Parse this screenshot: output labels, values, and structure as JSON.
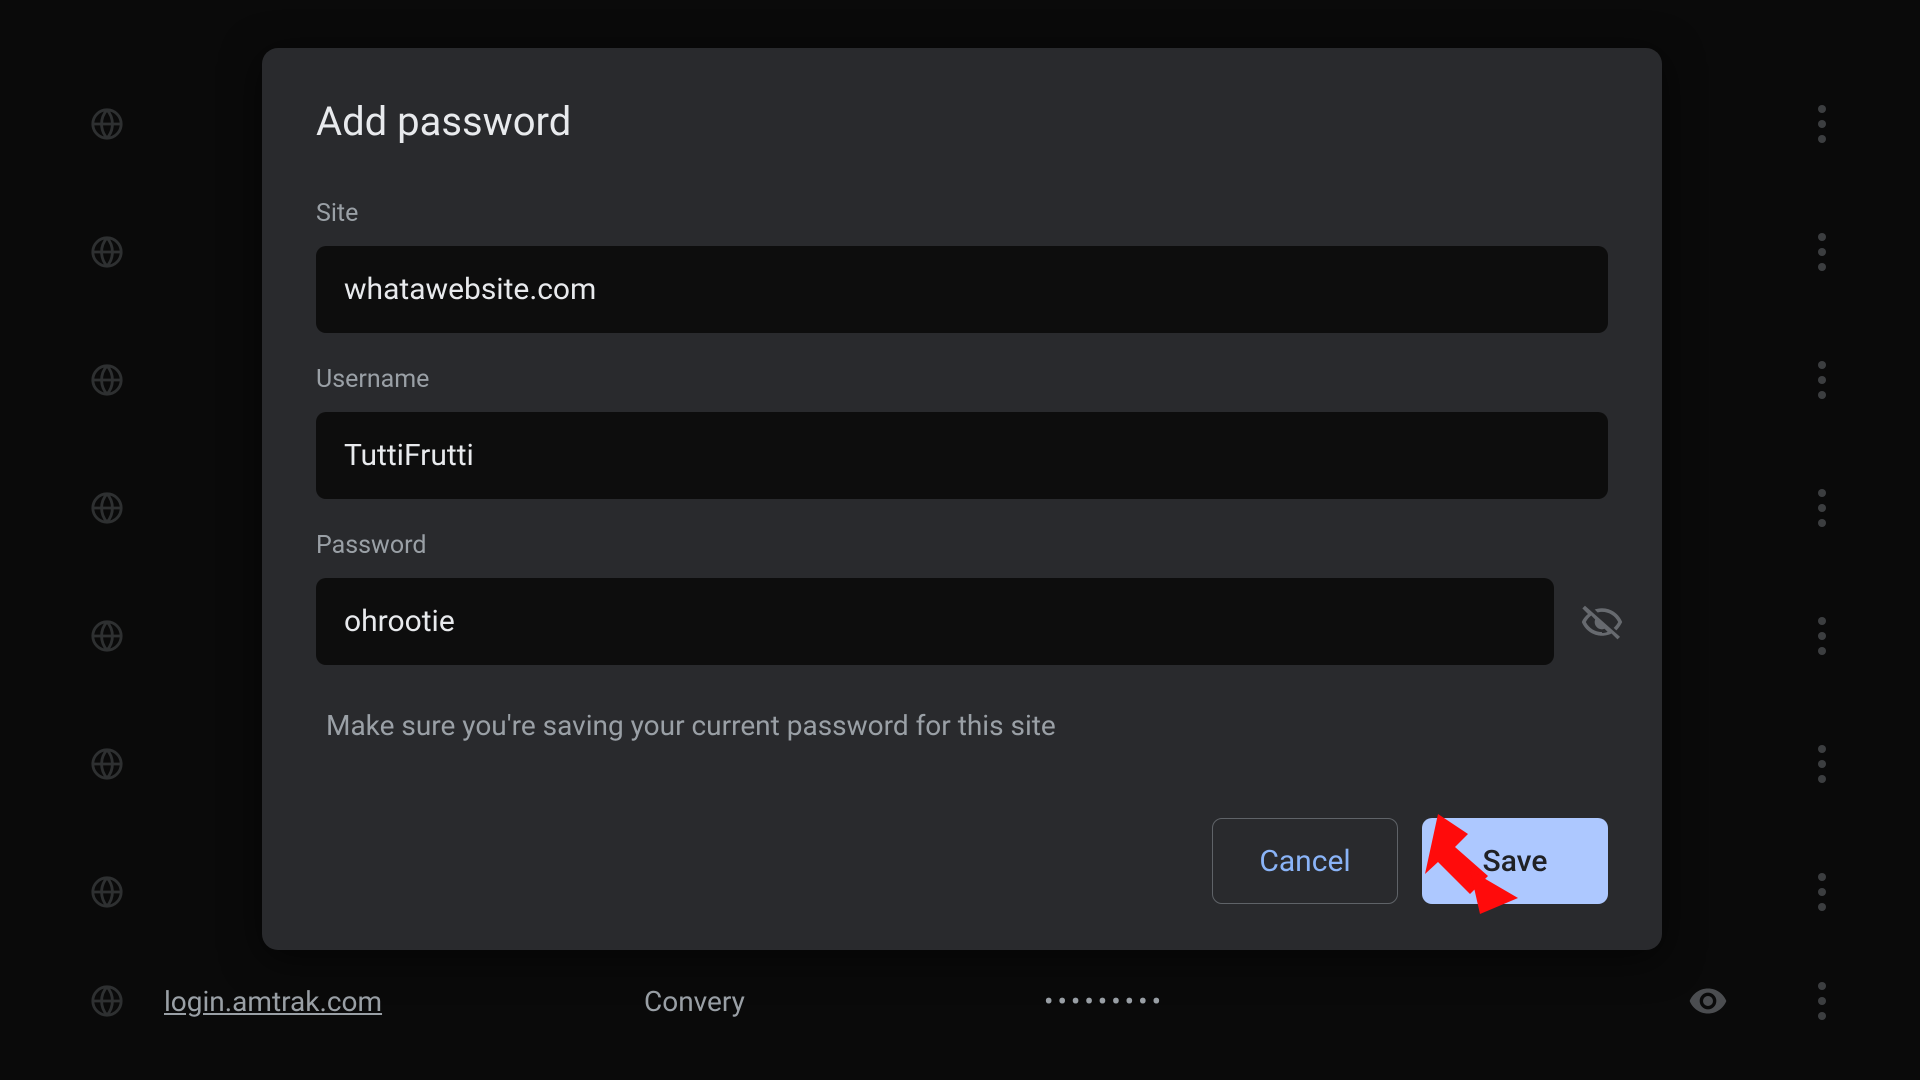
{
  "dialog": {
    "title": "Add password",
    "site_label": "Site",
    "site_value": "whatawebsite.com",
    "username_label": "Username",
    "username_value": "TuttiFrutti",
    "password_label": "Password",
    "password_value": "ohrootie",
    "helper": "Make sure you're saving your current password for this site",
    "cancel": "Cancel",
    "save": "Save"
  },
  "bg_rows": [
    {
      "site": "",
      "user": "",
      "pass": ""
    },
    {
      "site": "",
      "user": "",
      "pass": ""
    },
    {
      "site": "",
      "user": "",
      "pass": ""
    },
    {
      "site": "",
      "user": "",
      "pass": ""
    },
    {
      "site": "",
      "user": "",
      "pass": ""
    },
    {
      "site": "",
      "user": "",
      "pass": ""
    },
    {
      "site": "",
      "user": "",
      "pass": ""
    }
  ],
  "visible_row": {
    "site": "login.amtrak.com",
    "user": "Convery",
    "pass": "•••••••••"
  },
  "colors": {
    "dialog_bg": "#292a2d",
    "input_bg": "#0d0d0d",
    "accent_text": "#8ab4f8",
    "save_bg": "#adc8ff",
    "muted": "#9aa0a6",
    "arrow": "#ff0b0b"
  }
}
